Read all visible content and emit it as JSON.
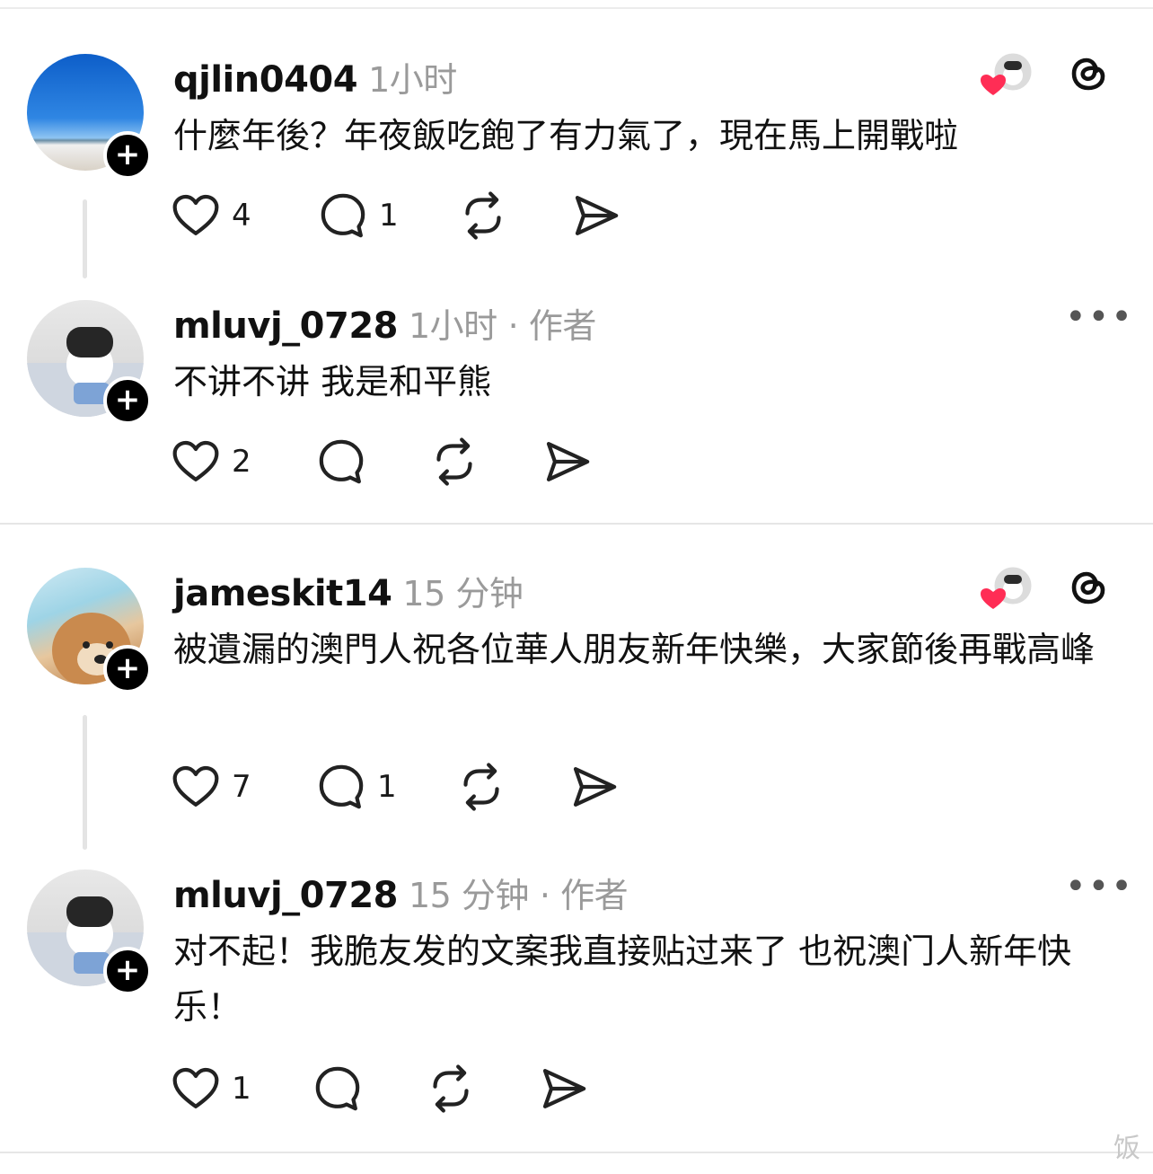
{
  "posts": [
    {
      "username": "qjlin0404",
      "time": "1小时",
      "author_tag": "",
      "text": "什麼年後？年夜飯吃飽了有力氣了，現在馬上開戰啦",
      "likes": "4",
      "replies": "1",
      "right_icon": "threads-icon",
      "avatar": "blue-sky-avatar"
    },
    {
      "username": "mluvj_0728",
      "time": "1小时",
      "author_tag": "· 作者",
      "text": "不讲不讲 我是和平熊",
      "likes": "2",
      "replies": "",
      "right_icon": "more-icon",
      "avatar": "bear-doll-avatar"
    },
    {
      "username": "jameskit14",
      "time": "15 分钟",
      "author_tag": "",
      "text": "被遺漏的澳門人祝各位華人朋友新年快樂，大家節後再戰高峰",
      "likes": "7",
      "replies": "1",
      "right_icon": "threads-icon",
      "avatar": "dog-avatar"
    },
    {
      "username": "mluvj_0728",
      "time": "15 分钟",
      "author_tag": "· 作者",
      "text": "对不起！我脆友发的文案我直接贴过来了 也祝澳门人新年快乐！",
      "likes": "1",
      "replies": "",
      "right_icon": "more-icon",
      "avatar": "bear-doll-avatar"
    }
  ],
  "more_label": "•••",
  "watermark": "饭",
  "colors": {
    "like_heart": "#ff2d55",
    "meta_gray": "#9a9a9a"
  }
}
